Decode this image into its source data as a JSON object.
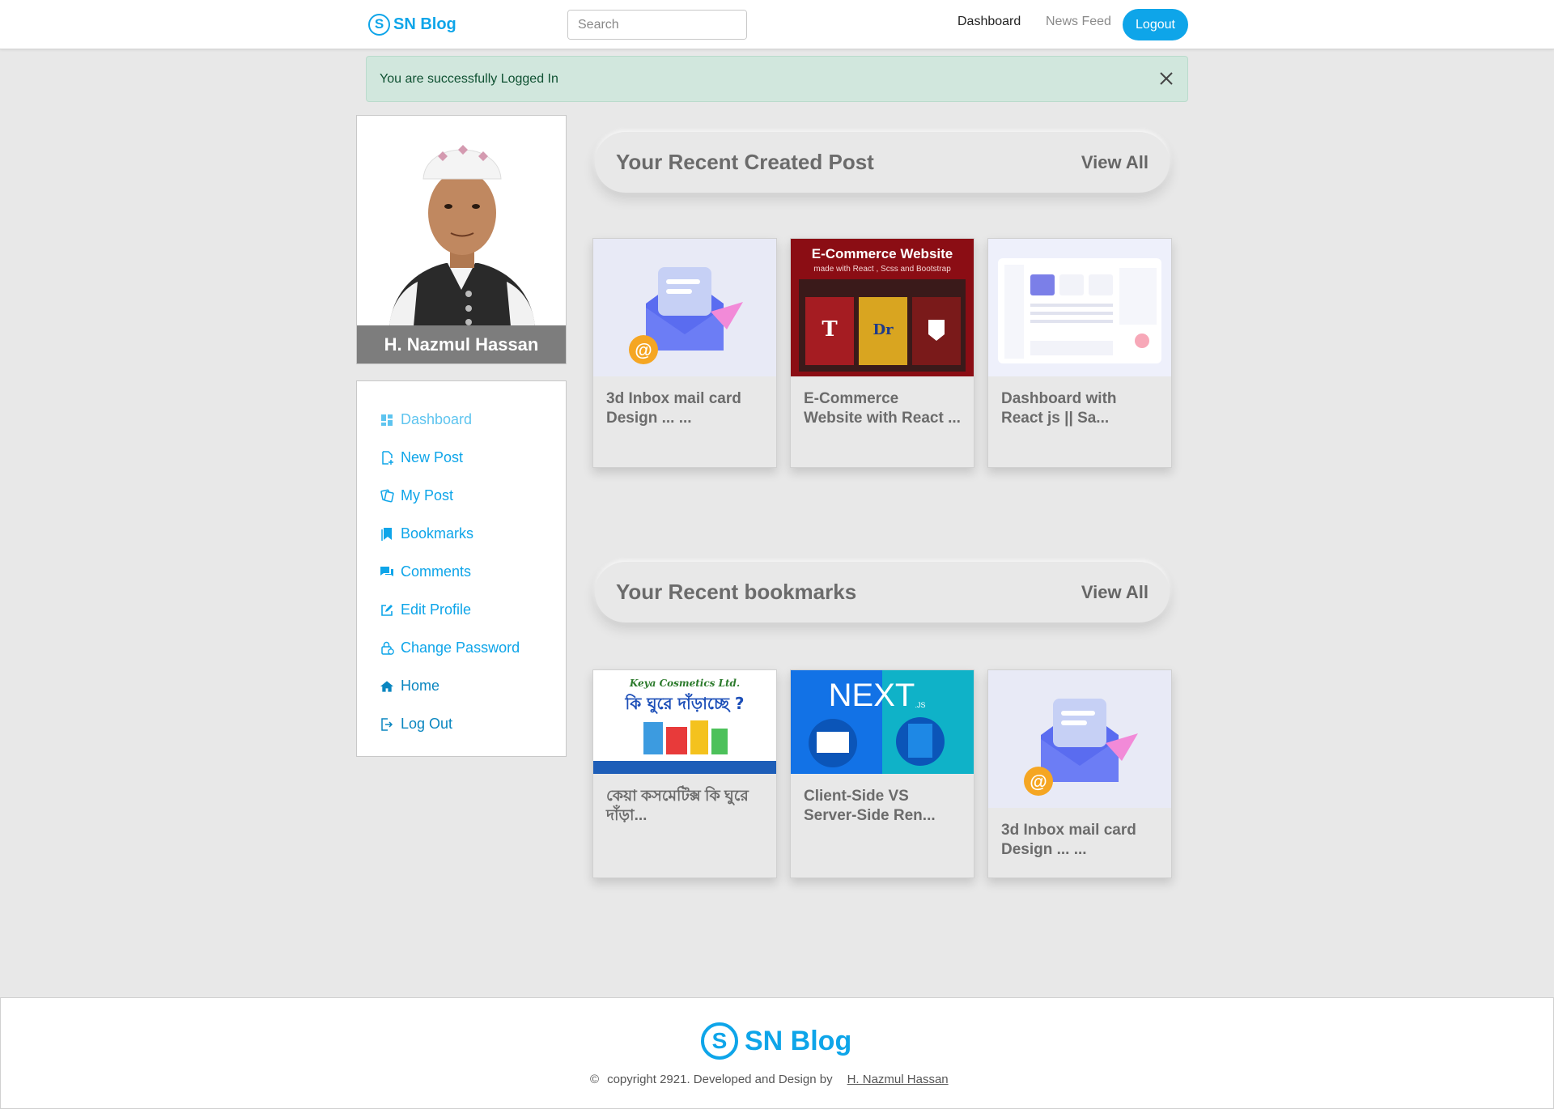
{
  "navbar": {
    "brand": "SN Blog",
    "brand_icon": "S",
    "search_placeholder": "Search",
    "links": {
      "dashboard": "Dashboard",
      "news_feed": "News Feed"
    },
    "logout": "Logout"
  },
  "alert": {
    "message": "You are successfully Logged In"
  },
  "profile": {
    "name": "H. Nazmul Hassan"
  },
  "sidebar": {
    "items": [
      {
        "label": "Dashboard",
        "icon": "dashboard-icon"
      },
      {
        "label": "New Post",
        "icon": "new-post-icon"
      },
      {
        "label": "My Post",
        "icon": "my-post-icon"
      },
      {
        "label": "Bookmarks",
        "icon": "bookmark-icon"
      },
      {
        "label": "Comments",
        "icon": "comments-icon"
      },
      {
        "label": "Edit Profile",
        "icon": "edit-icon"
      },
      {
        "label": "Change Password",
        "icon": "lock-icon"
      },
      {
        "label": "Home",
        "icon": "home-icon"
      },
      {
        "label": "Log Out",
        "icon": "logout-icon"
      }
    ]
  },
  "recent_posts": {
    "title": "Your Recent Created Post",
    "view_all": "View All",
    "cards": [
      {
        "title": "3d Inbox mail card Design ... ..."
      },
      {
        "title": "E-Commerce Website with React ...",
        "image_heading": "E-Commerce Website",
        "image_subheading": "made with React , Scss and Bootstrap"
      },
      {
        "title": "Dashboard with React js || Sa..."
      }
    ]
  },
  "recent_bookmarks": {
    "title": "Your Recent bookmarks",
    "view_all": "View All",
    "cards": [
      {
        "title": "কেয়া কসমেটিক্স কি ঘুরে দাঁড়া...",
        "image_heading": "কি ঘুরে দাঁড়াচ্ছে ?",
        "image_brand": "Keya Cosmetics Ltd."
      },
      {
        "title": "Client-Side VS Server-Side Ren...",
        "image_heading": "NEXT",
        "image_sub": ".JS"
      },
      {
        "title": "3d Inbox mail card Design ... ..."
      }
    ]
  },
  "footer": {
    "brand": "SN Blog",
    "brand_icon": "S",
    "copyright_symbol": "©",
    "copyright": "copyright 2921. Developed and Design by",
    "author": "H. Nazmul Hassan"
  },
  "colors": {
    "accent": "#0ea5e9",
    "alert_bg": "#d1e7dd",
    "alert_text": "#0f5132",
    "page_bg": "#e8e8e8"
  }
}
